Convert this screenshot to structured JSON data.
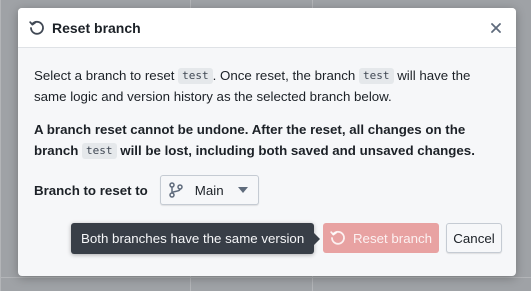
{
  "dialog": {
    "title": "Reset branch",
    "title_icon": "reset-icon",
    "close_icon": "close-icon"
  },
  "body": {
    "intro": {
      "part1": "Select a branch to reset",
      "branch_code": "test",
      "part2": ". Once reset, the branch",
      "branch_code2": "test",
      "part3": "will have the same logic and version history as the selected branch below."
    },
    "warning": {
      "part1": "A branch reset cannot be undone. After the reset, all changes on the branch",
      "branch_code": "test",
      "part2": "will be lost, including both saved and unsaved changes."
    },
    "select": {
      "label": "Branch to reset to",
      "value": "Main",
      "icon": "git-branch-icon"
    }
  },
  "footer": {
    "tooltip": "Both branches have the same version",
    "reset_label": "Reset branch",
    "cancel_label": "Cancel"
  },
  "colors": {
    "danger_disabled": "#e8a2a2",
    "tooltip_bg": "#383e47",
    "text": "#1c2127"
  }
}
